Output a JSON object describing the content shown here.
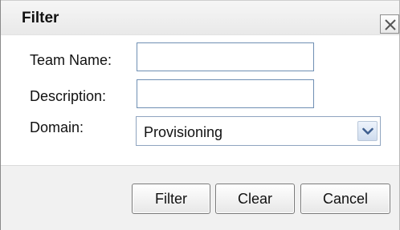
{
  "dialog": {
    "title": "Filter",
    "close_icon": "close-icon"
  },
  "form": {
    "team_name": {
      "label": "Team Name:",
      "value": ""
    },
    "description": {
      "label": "Description:",
      "value": ""
    },
    "domain": {
      "label": "Domain:",
      "selected": "Provisioning",
      "arrow_icon": "chevron-down-icon"
    }
  },
  "buttons": {
    "filter": "Filter",
    "clear": "Clear",
    "cancel": "Cancel"
  },
  "colors": {
    "title_bar": "#efefef",
    "footer": "#f1f1f1",
    "input_border": "#6f8fb3",
    "select_arrow": "#4a6fa5"
  }
}
